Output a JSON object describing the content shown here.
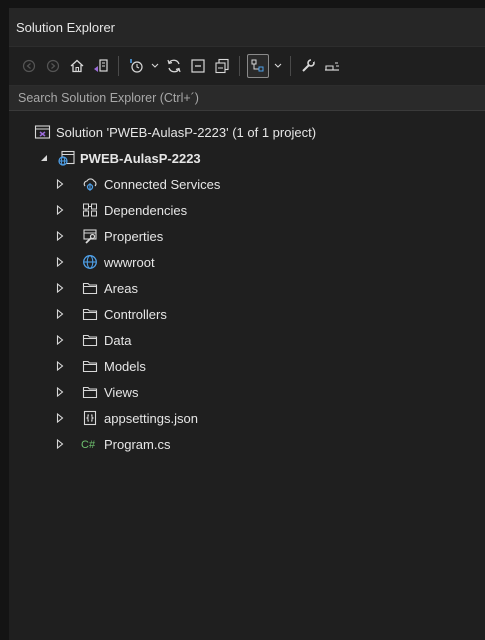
{
  "panel": {
    "title": "Solution Explorer"
  },
  "search": {
    "placeholder": "Search Solution Explorer (Ctrl+´)"
  },
  "solution": {
    "label": "Solution 'PWEB-AulasP-2223' (1 of 1 project)"
  },
  "project": {
    "label": "PWEB-AulasP-2223"
  },
  "items": [
    {
      "label": "Connected Services",
      "icon": "connected-services-icon"
    },
    {
      "label": "Dependencies",
      "icon": "dependencies-icon"
    },
    {
      "label": "Properties",
      "icon": "properties-icon"
    },
    {
      "label": "wwwroot",
      "icon": "globe-icon"
    },
    {
      "label": "Areas",
      "icon": "folder-icon"
    },
    {
      "label": "Controllers",
      "icon": "folder-icon"
    },
    {
      "label": "Data",
      "icon": "folder-icon"
    },
    {
      "label": "Models",
      "icon": "folder-icon"
    },
    {
      "label": "Views",
      "icon": "folder-icon"
    },
    {
      "label": "appsettings.json",
      "icon": "json-file-icon"
    },
    {
      "label": "Program.cs",
      "icon": "csharp-file-icon"
    }
  ],
  "colors": {
    "background": "#1f1f1f",
    "accent_blue": "#4fa0e8",
    "folder_outline": "#d8d8d8",
    "csharp_green": "#6fc26f"
  }
}
